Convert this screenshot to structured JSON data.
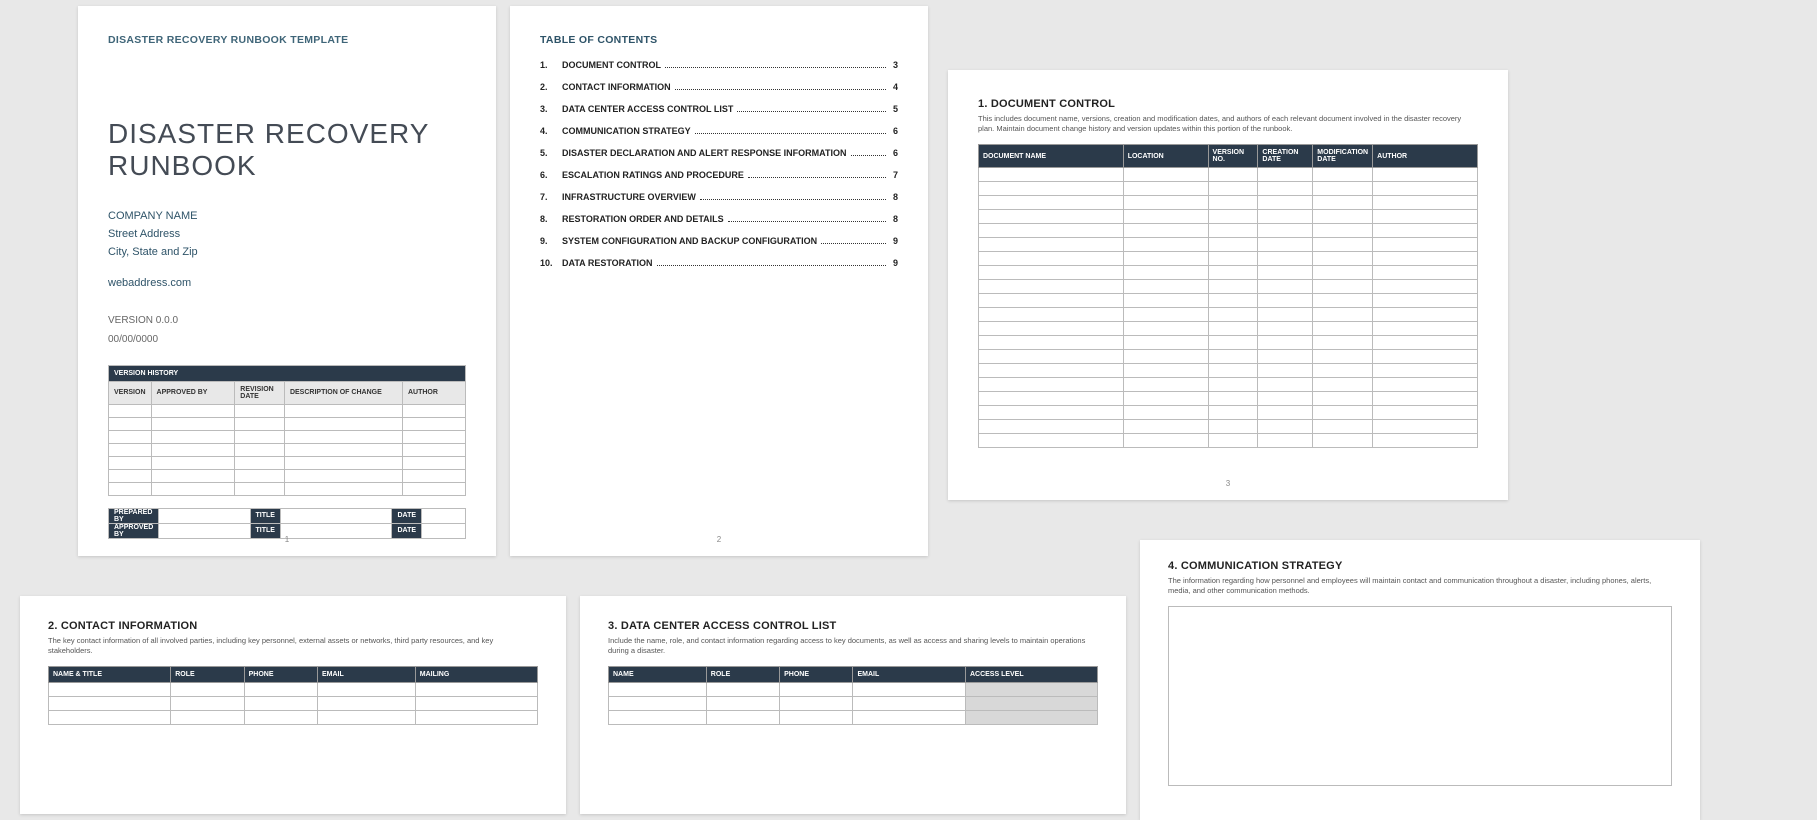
{
  "page1": {
    "template_label": "DISASTER RECOVERY RUNBOOK TEMPLATE",
    "title_line1": "DISASTER RECOVERY",
    "title_line2": "RUNBOOK",
    "company": "COMPANY NAME",
    "street": "Street Address",
    "city": "City, State and Zip",
    "web": "webaddress.com",
    "version": "VERSION 0.0.0",
    "date": "00/00/0000",
    "vh_title": "VERSION HISTORY",
    "vh_cols": {
      "c1": "VERSION",
      "c2": "APPROVED BY",
      "c3": "REVISION DATE",
      "c4": "DESCRIPTION OF CHANGE",
      "c5": "AUTHOR"
    },
    "sig": {
      "prepared": "PREPARED BY",
      "approved": "APPROVED BY",
      "title": "TITLE",
      "date": "DATE"
    },
    "pageno": "1"
  },
  "page2": {
    "toc_label": "TABLE OF CONTENTS",
    "items": [
      {
        "n": "1.",
        "t": "DOCUMENT CONTROL",
        "p": "3"
      },
      {
        "n": "2.",
        "t": "CONTACT INFORMATION",
        "p": "4"
      },
      {
        "n": "3.",
        "t": "DATA CENTER ACCESS CONTROL LIST",
        "p": "5"
      },
      {
        "n": "4.",
        "t": "COMMUNICATION STRATEGY",
        "p": "6"
      },
      {
        "n": "5.",
        "t": "DISASTER DECLARATION AND ALERT RESPONSE INFORMATION",
        "p": "6"
      },
      {
        "n": "6.",
        "t": "ESCALATION RATINGS AND PROCEDURE",
        "p": "7"
      },
      {
        "n": "7.",
        "t": "INFRASTRUCTURE OVERVIEW",
        "p": "8"
      },
      {
        "n": "8.",
        "t": "RESTORATION ORDER AND DETAILS",
        "p": "8"
      },
      {
        "n": "9.",
        "t": "SYSTEM CONFIGURATION AND BACKUP CONFIGURATION",
        "p": "9"
      },
      {
        "n": "10.",
        "t": "DATA RESTORATION",
        "p": "9"
      }
    ],
    "pageno": "2"
  },
  "page3": {
    "heading": "1.  DOCUMENT CONTROL",
    "desc": "This includes document name, versions, creation and modification dates, and authors of each relevant document involved in the disaster recovery plan. Maintain document change history and version updates within this portion of the runbook.",
    "cols": {
      "c1": "DOCUMENT NAME",
      "c2": "LOCATION",
      "c3": "VERSION NO.",
      "c4": "CREATION DATE",
      "c5": "MODIFICATION DATE",
      "c6": "AUTHOR"
    },
    "pageno": "3"
  },
  "page4": {
    "heading": "2.  CONTACT INFORMATION",
    "desc": "The key contact information of all involved parties, including key personnel, external assets or networks, third party resources, and key stakeholders.",
    "cols": {
      "c1": "NAME & TITLE",
      "c2": "ROLE",
      "c3": "PHONE",
      "c4": "EMAIL",
      "c5": "MAILING"
    }
  },
  "page5": {
    "heading": "3.  DATA CENTER ACCESS CONTROL LIST",
    "desc": "Include the name, role, and contact information regarding access to key documents, as well as access and sharing levels to maintain operations during a disaster.",
    "cols": {
      "c1": "NAME",
      "c2": "ROLE",
      "c3": "PHONE",
      "c4": "EMAIL",
      "c5": "ACCESS LEVEL"
    }
  },
  "page6": {
    "heading": "4.  COMMUNICATION STRATEGY",
    "desc": "The information regarding how personnel and employees will maintain contact and communication throughout a disaster, including phones, alerts, media, and other communication methods."
  }
}
